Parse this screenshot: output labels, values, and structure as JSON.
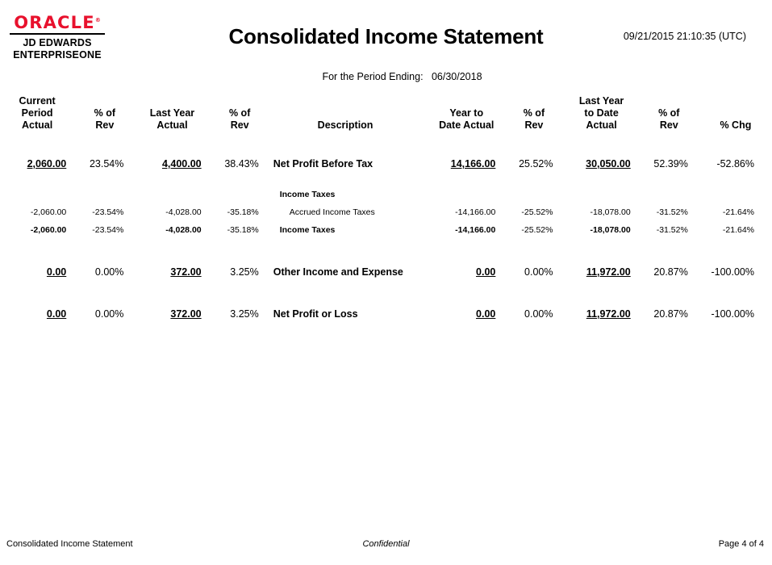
{
  "branding": {
    "oracle_wordmark": "ORACLE",
    "registered_mark": "®",
    "product_line1": "JD EDWARDS",
    "product_line2": "ENTERPRISEONE",
    "logo_color": "#e8112d"
  },
  "header": {
    "title": "Consolidated Income Statement",
    "timestamp": "09/21/2015 21:10:35 (UTC)",
    "period_label": "For the Period Ending:",
    "period_value": "06/30/2018"
  },
  "columns": {
    "current_period_actual": "Current\nPeriod\nActual",
    "cpa_l1": "Current",
    "cpa_l2": "Period",
    "cpa_l3": "Actual",
    "pct_rev_l1": "% of",
    "pct_rev_l2": "Rev",
    "last_year_actual_l1": "Last Year",
    "last_year_actual_l2": "Actual",
    "description": "Description",
    "ytd_actual_l1": "Year to",
    "ytd_actual_l2": "Date Actual",
    "last_year_ytd_l1": "Last Year",
    "last_year_ytd_l2": "to Date",
    "last_year_ytd_l3": "Actual",
    "pct_chg": "% Chg"
  },
  "rows": [
    {
      "type": "major",
      "description": "Net Profit Before Tax",
      "current_period_actual": "2,060.00",
      "cpa_pct": "23.54%",
      "last_year_actual": "4,400.00",
      "lya_pct": "38.43%",
      "ytd_actual": "14,166.00",
      "ytd_pct": "25.52%",
      "last_year_ytd": "30,050.00",
      "lyytd_pct": "52.39%",
      "pct_chg": "-52.86%"
    },
    {
      "type": "section",
      "description": "Income Taxes",
      "current_period_actual": "",
      "cpa_pct": "",
      "last_year_actual": "",
      "lya_pct": "",
      "ytd_actual": "",
      "ytd_pct": "",
      "last_year_ytd": "",
      "lyytd_pct": "",
      "pct_chg": ""
    },
    {
      "type": "detail",
      "description": "Accrued Income Taxes",
      "current_period_actual": "-2,060.00",
      "cpa_pct": "-23.54%",
      "last_year_actual": "-4,028.00",
      "lya_pct": "-35.18%",
      "ytd_actual": "-14,166.00",
      "ytd_pct": "-25.52%",
      "last_year_ytd": "-18,078.00",
      "lyytd_pct": "-31.52%",
      "pct_chg": "-21.64%"
    },
    {
      "type": "subtotal",
      "description": "Income Taxes",
      "current_period_actual": "-2,060.00",
      "cpa_pct": "-23.54%",
      "last_year_actual": "-4,028.00",
      "lya_pct": "-35.18%",
      "ytd_actual": "-14,166.00",
      "ytd_pct": "-25.52%",
      "last_year_ytd": "-18,078.00",
      "lyytd_pct": "-31.52%",
      "pct_chg": "-21.64%"
    },
    {
      "type": "major",
      "description": "Other Income and Expense",
      "current_period_actual": "0.00",
      "cpa_pct": "0.00%",
      "last_year_actual": "372.00",
      "lya_pct": "3.25%",
      "ytd_actual": "0.00",
      "ytd_pct": "0.00%",
      "last_year_ytd": "11,972.00",
      "lyytd_pct": "20.87%",
      "pct_chg": "-100.00%"
    },
    {
      "type": "major",
      "description": "Net Profit or Loss",
      "current_period_actual": "0.00",
      "cpa_pct": "0.00%",
      "last_year_actual": "372.00",
      "lya_pct": "3.25%",
      "ytd_actual": "0.00",
      "ytd_pct": "0.00%",
      "last_year_ytd": "11,972.00",
      "lyytd_pct": "20.87%",
      "pct_chg": "-100.00%"
    }
  ],
  "footer": {
    "left": "Consolidated Income Statement",
    "center": "Confidential",
    "right": "Page 4 of 4"
  }
}
